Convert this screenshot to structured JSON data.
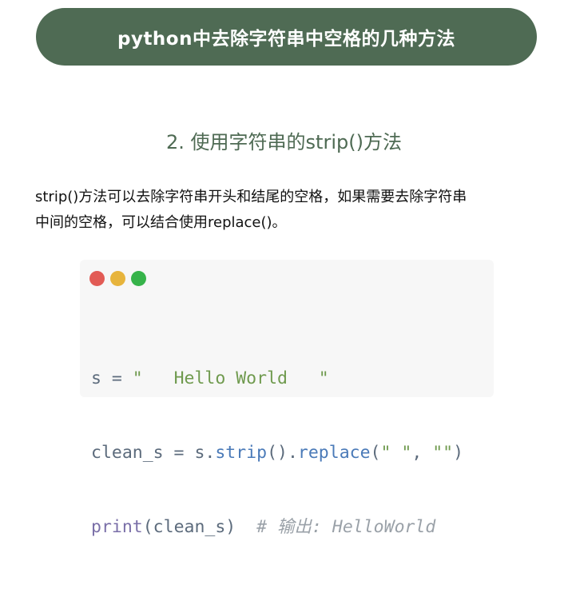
{
  "banner": {
    "title": "python中去除字符串中空格的几种方法"
  },
  "section": {
    "heading": "2. 使用字符串的strip()方法"
  },
  "paragraph": {
    "line1": "strip()方法可以去除字符串开头和结尾的空格，如果需要去除字符串",
    "line2": "中间的空格，可以结合使用replace()。"
  },
  "code_window": {
    "dots": [
      "red",
      "yellow",
      "green"
    ],
    "colors": {
      "red": "#e25b55",
      "yellow": "#e7b43c",
      "green": "#36b34a"
    },
    "line1": {
      "var": "s",
      "op": " = ",
      "str": "\"   Hello World   \""
    },
    "line2": {
      "var": "clean_s",
      "op": " = ",
      "obj": "s.",
      "method1": "strip",
      "paren1": "().",
      "method2": "replace",
      "paren_open": "(",
      "arg1": "\" \"",
      "comma": ", ",
      "arg2": "\"\"",
      "paren_close": ")"
    },
    "line3": {
      "fn": "print",
      "args": "(clean_s)",
      "comment": "# 输出: HelloWorld"
    }
  },
  "accent_color": "#4f6b54"
}
